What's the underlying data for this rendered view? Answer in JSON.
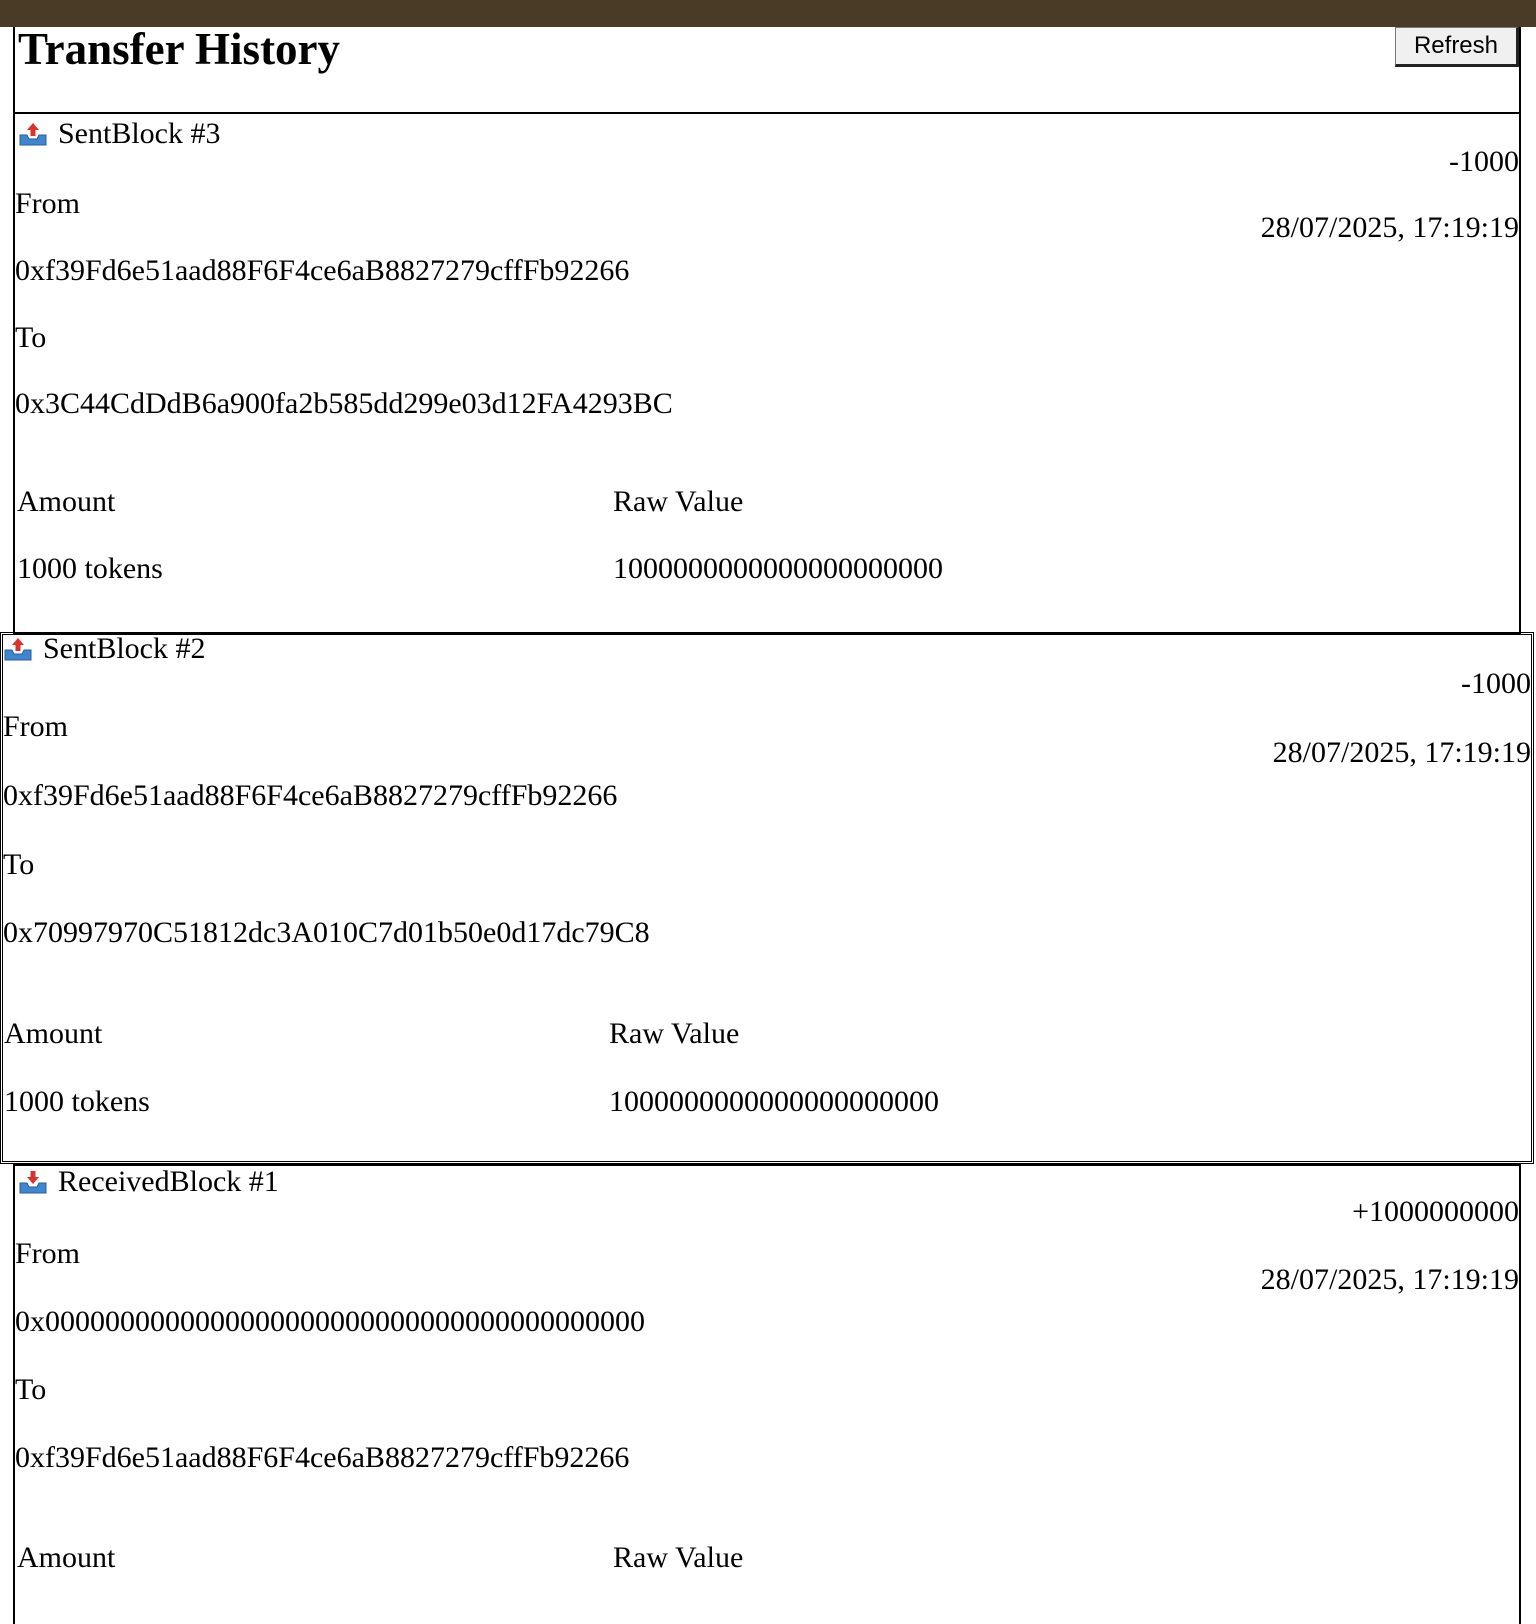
{
  "header": {
    "title": "Transfer History",
    "refresh_label": "Refresh"
  },
  "labels": {
    "from": "From",
    "to": "To",
    "amount": "Amount",
    "raw_value": "Raw Value"
  },
  "transfers": [
    {
      "title": "SentBlock #3",
      "icon": "outbox-icon",
      "delta": "-1000",
      "timestamp": "28/07/2025, 17:19:19",
      "from": "0xf39Fd6e51aad88F6F4ce6aB8827279cffFb92266",
      "to": "0x3C44CdDdB6a900fa2b585dd299e03d12FA4293BC",
      "amount": "1000 tokens",
      "raw_value": "1000000000000000000000"
    },
    {
      "title": "SentBlock #2",
      "icon": "outbox-icon",
      "delta": "-1000",
      "timestamp": "28/07/2025, 17:19:19",
      "from": "0xf39Fd6e51aad88F6F4ce6aB8827279cffFb92266",
      "to": "0x70997970C51812dc3A010C7d01b50e0d17dc79C8",
      "amount": "1000 tokens",
      "raw_value": "1000000000000000000000"
    },
    {
      "title": "ReceivedBlock #1",
      "icon": "inbox-icon",
      "delta": "+1000000000",
      "timestamp": "28/07/2025, 17:19:19",
      "from": "0x0000000000000000000000000000000000000000",
      "to": "0xf39Fd6e51aad88F6F4ce6aB8827279cffFb92266",
      "amount": "",
      "raw_value": ""
    }
  ],
  "colors": {
    "topbar": "#4a3b27",
    "icon_tray": "#3f86d0",
    "icon_arrow": "#d9342b"
  }
}
